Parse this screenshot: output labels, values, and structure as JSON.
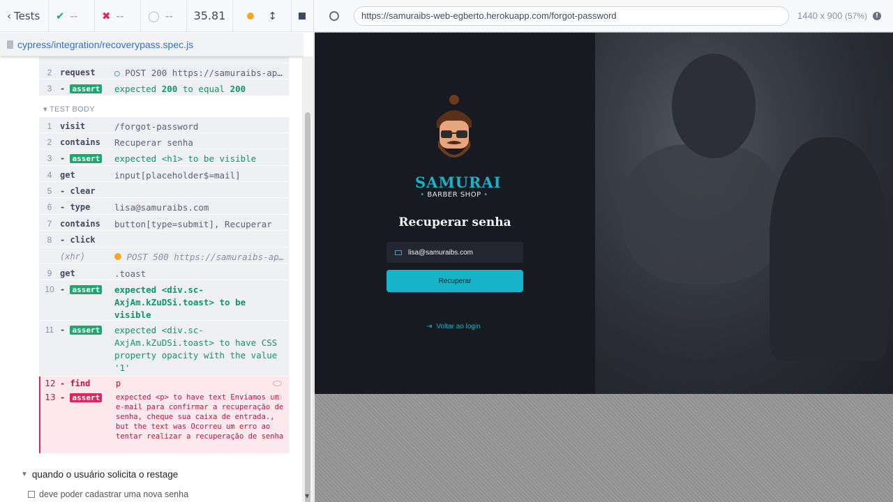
{
  "topbar": {
    "tests_label": "Tests",
    "passed": "--",
    "failed": "--",
    "pending": "--",
    "duration": "35.81"
  },
  "spec": {
    "path": "cypress/integration/recoverypass.spec.js"
  },
  "before_hook": [
    {
      "num": "2",
      "name": "request",
      "msg": "POST 200 https://samuraibs-ap…"
    },
    {
      "num": "3",
      "name": "- assert",
      "badge": "assert",
      "msg_parts": [
        "expected ",
        "200",
        " to equal ",
        "200"
      ]
    }
  ],
  "test_body_label": "TEST BODY",
  "commands": [
    {
      "num": "1",
      "name": "visit",
      "msg": "/forgot-password"
    },
    {
      "num": "2",
      "name": "contains",
      "msg": "Recuperar senha"
    },
    {
      "num": "3",
      "badge": "assert",
      "msg": "expected <h1> to be visible"
    },
    {
      "num": "4",
      "name": "get",
      "msg": "input[placeholder$=mail]"
    },
    {
      "num": "5",
      "name": "- clear",
      "msg": ""
    },
    {
      "num": "6",
      "name": "- type",
      "msg": "lisa@samuraibs.com"
    },
    {
      "num": "7",
      "name": "contains",
      "msg": "button[type=submit], Recuperar"
    },
    {
      "num": "8",
      "name": "- click",
      "msg": ""
    },
    {
      "num": "",
      "name": "(xhr)",
      "msg": "POST 500 https://samuraibs-ap…"
    },
    {
      "num": "9",
      "name": "get",
      "msg": ".toast"
    },
    {
      "num": "10",
      "badge": "assert",
      "msg": "expected <div.sc-AxjAm.kZuDSi.toast> to be visible"
    },
    {
      "num": "11",
      "badge": "assert",
      "msg": "expected <div.sc-AxjAm.kZuDSi.toast> to have CSS property opacity with the value '1'"
    }
  ],
  "failure": {
    "find_num": "12",
    "find_name": "- find",
    "find_msg": "p",
    "assert_num": "13",
    "assert_badge": "assert",
    "assert_msg": "expected <p> to have text Enviamos um e-mail para confirmar a recuperação de senha, cheque sua caixa de entrada., but the text was Ocorreu um erro ao tentar realizar a recuperação de senha"
  },
  "suite": {
    "title": "quando o usuário solicita o restage",
    "test": "deve poder cadastrar uma nova senha"
  },
  "browser": {
    "url": "https://samuraibs-web-egberto.herokuapp.com/forgot-password",
    "viewport": "1440 x 900",
    "zoom": "(57%)"
  },
  "app": {
    "brand": "SAMURAI",
    "brand_sub": "BARBER SHOP",
    "heading": "Recuperar senha",
    "email_value": "lisa@samuraibs.com",
    "submit_label": "Recuperar",
    "back_link": "Voltar ao login",
    "accent_color": "#17b3c8"
  }
}
